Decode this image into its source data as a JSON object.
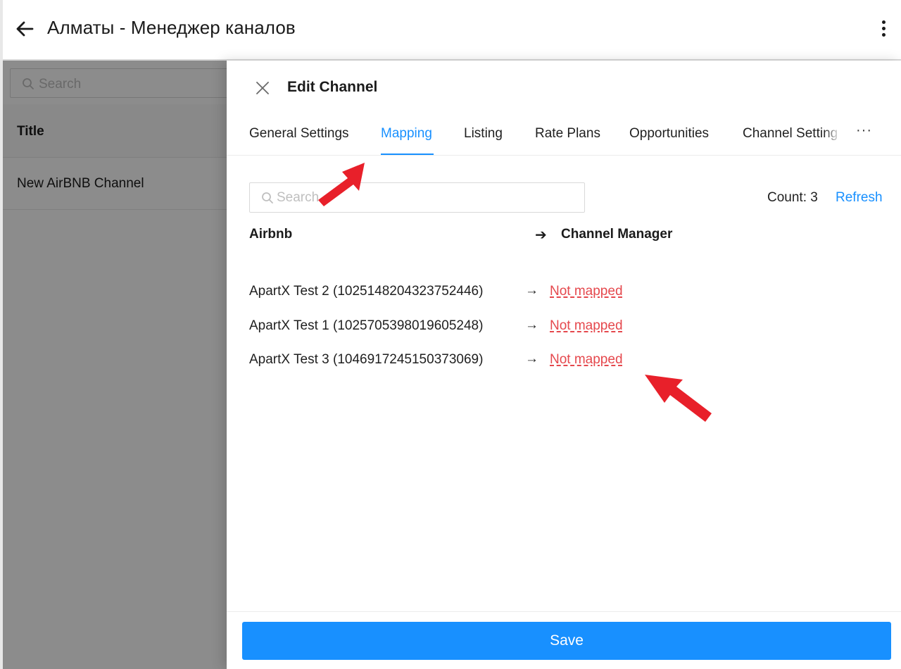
{
  "app": {
    "title": "Алматы - Менеджер каналов",
    "back_icon": "arrow-left-icon",
    "menu_icon": "kebab-menu-icon"
  },
  "background_page": {
    "search_placeholder": "Search",
    "table_header": "Title",
    "rows": [
      "New AirBNB Channel"
    ]
  },
  "drawer": {
    "title": "Edit Channel",
    "close_icon": "close-icon",
    "tabs": [
      {
        "label": "General Settings",
        "active": false
      },
      {
        "label": "Mapping",
        "active": true
      },
      {
        "label": "Listing",
        "active": false
      },
      {
        "label": "Rate Plans",
        "active": false
      },
      {
        "label": "Opportunities",
        "active": false
      },
      {
        "label": "Channel Setting",
        "active": false
      }
    ],
    "tabs_more": "···",
    "search_placeholder": "Search",
    "count_label": "Count: 3",
    "refresh_label": "Refresh",
    "columns": {
      "left": "Airbnb",
      "arrow": "➔",
      "right": "Channel Manager"
    },
    "mappings": [
      {
        "source": "ApartX Test 2 (1025148204323752446)",
        "arrow": "→",
        "target": "Not mapped"
      },
      {
        "source": "ApartX Test 1 (1025705398019605248)",
        "arrow": "→",
        "target": "Not mapped"
      },
      {
        "source": "ApartX Test 3 (1046917245150373069)",
        "arrow": "→",
        "target": "Not mapped"
      }
    ],
    "save_label": "Save"
  },
  "colors": {
    "accent": "#1890ff",
    "not_mapped": "#e5484d",
    "annotation_arrow": "#e8202a",
    "overlay": "rgba(0,0,0,0.45)"
  }
}
